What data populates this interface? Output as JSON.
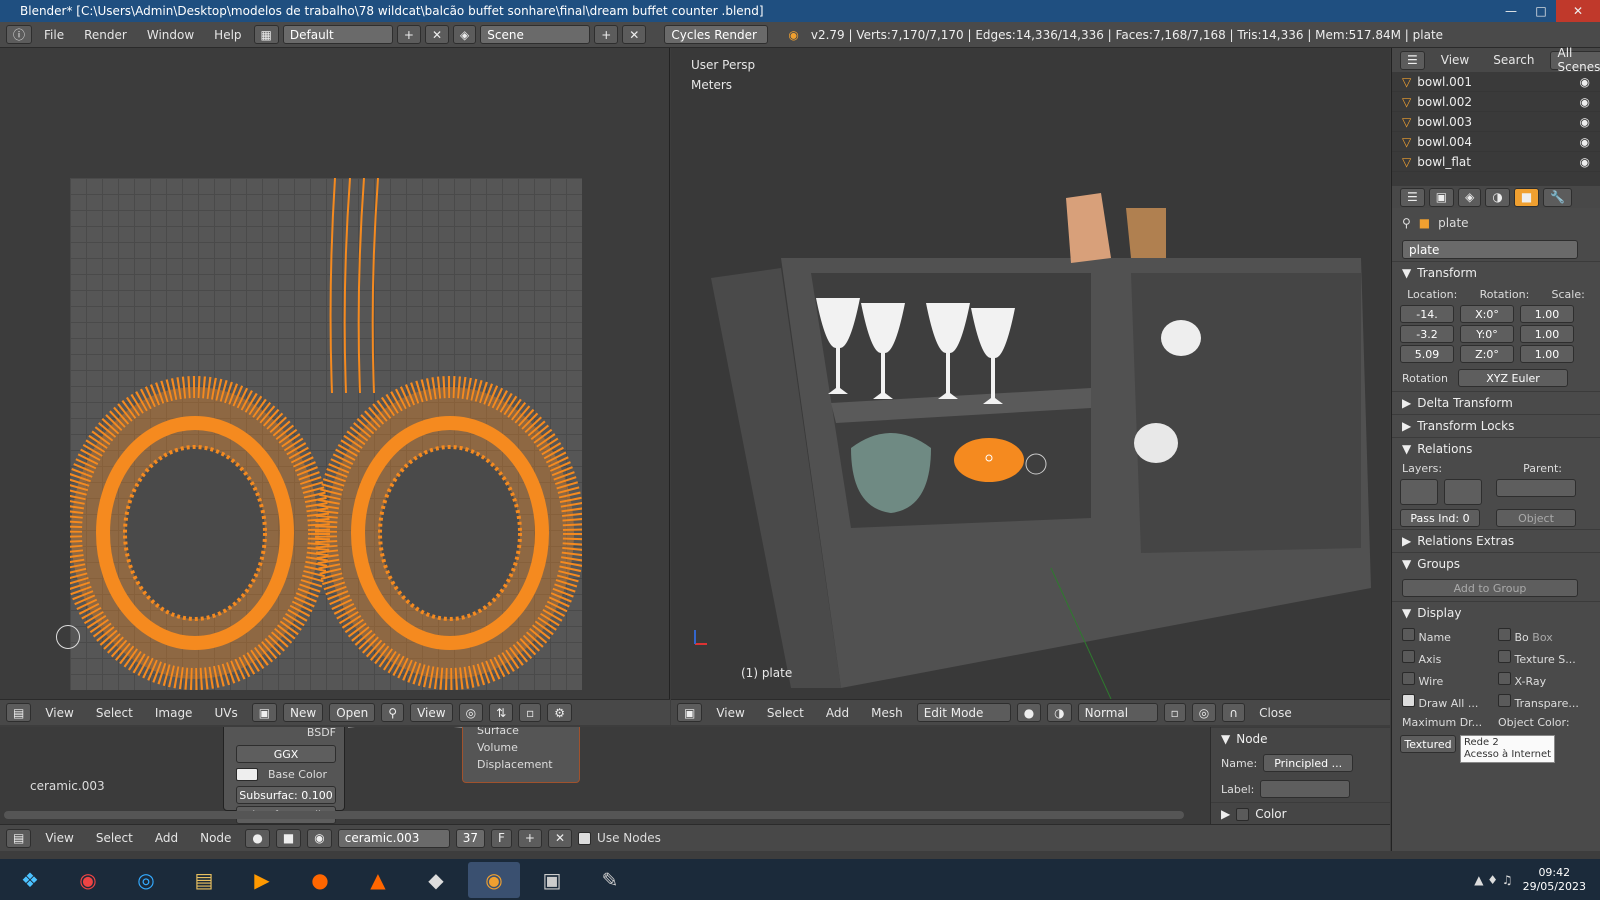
{
  "window": {
    "title": "Blender* [C:\\Users\\Admin\\Desktop\\modelos de trabalho\\78 wildcat\\balcão buffet sonhare\\final\\dream buffet counter .blend]"
  },
  "topbar": {
    "menus": [
      "File",
      "Render",
      "Window",
      "Help"
    ],
    "layout": "Default",
    "scene": "Scene",
    "engine": "Cycles Render",
    "stats": "v2.79 | Verts:7,170/7,170 | Edges:14,336/14,336 | Faces:7,168/7,168 | Tris:14,336 | Mem:517.84M | plate"
  },
  "uv_header": {
    "menus": [
      "View",
      "Select",
      "Image",
      "UVs"
    ],
    "new": "New",
    "open": "Open",
    "view": "View"
  },
  "viewport": {
    "persp": "User Persp",
    "units": "Meters",
    "object_label": "(1) plate",
    "menus": [
      "View",
      "Select",
      "Add",
      "Mesh"
    ],
    "mode": "Edit Mode",
    "orientation": "Normal",
    "close": "Close"
  },
  "node_editor": {
    "bsdf": "BSDF",
    "distribution": "GGX",
    "base_color": "Base Color",
    "subsurface": "Subsurfac: 0.100",
    "subsurface_radius": "Subsurface Radius",
    "outputs": [
      "Surface",
      "Volume",
      "Displacement"
    ],
    "material_name_left": "ceramic.003",
    "footer_menus": [
      "View",
      "Select",
      "Add",
      "Node"
    ],
    "material": "ceramic.003",
    "users": "37",
    "fake": "F",
    "use_nodes": "Use Nodes"
  },
  "node_props": {
    "header": "Node",
    "name_label": "Name:",
    "name_value": "Principled ...",
    "label_label": "Label:",
    "color": "Color"
  },
  "outliner": {
    "tabs": [
      "View",
      "Search",
      "All Scenes"
    ],
    "items": [
      "bowl.001",
      "bowl.002",
      "bowl.003",
      "bowl.004",
      "bowl_flat"
    ]
  },
  "properties": {
    "object_name": "plate",
    "breadcrumb": "plate",
    "transform": "Transform",
    "location_label": "Location:",
    "rotation_label": "Rotation:",
    "scale_label": "Scale:",
    "location": [
      "-14.",
      "-3.2",
      "5.09"
    ],
    "rotation": [
      "X:0°",
      "Y:0°",
      "Z:0°"
    ],
    "scale": [
      "1.00",
      "1.00",
      "1.00"
    ],
    "rotation_mode_label": "Rotation",
    "rotation_mode": "XYZ Euler",
    "delta": "Delta Transform",
    "locks": "Transform Locks",
    "relations": "Relations",
    "layers_label": "Layers:",
    "parent_label": "Parent:",
    "parent_type": "Object",
    "pass_index": "Pass Ind: 0",
    "relations_extras": "Relations Extras",
    "groups": "Groups",
    "add_to_group": "Add to Group",
    "display": "Display",
    "name": "Name",
    "bo": "Bo",
    "box": "Box",
    "axis": "Axis",
    "texture_space": "Texture S...",
    "wire": "Wire",
    "xray": "X-Ray",
    "draw_all": "Draw All ...",
    "transparency": "Transpare...",
    "max_draw": "Maximum Dr...",
    "object_color": "Object Color:",
    "textured": "Textured",
    "tooltip_title": "Rede  2",
    "tooltip_sub": "Acesso à Internet"
  },
  "taskbar": {
    "time": "09:42",
    "date": "29/05/2023"
  },
  "colors": {
    "accent": "#f58a1f",
    "title": "#1f4f80"
  }
}
